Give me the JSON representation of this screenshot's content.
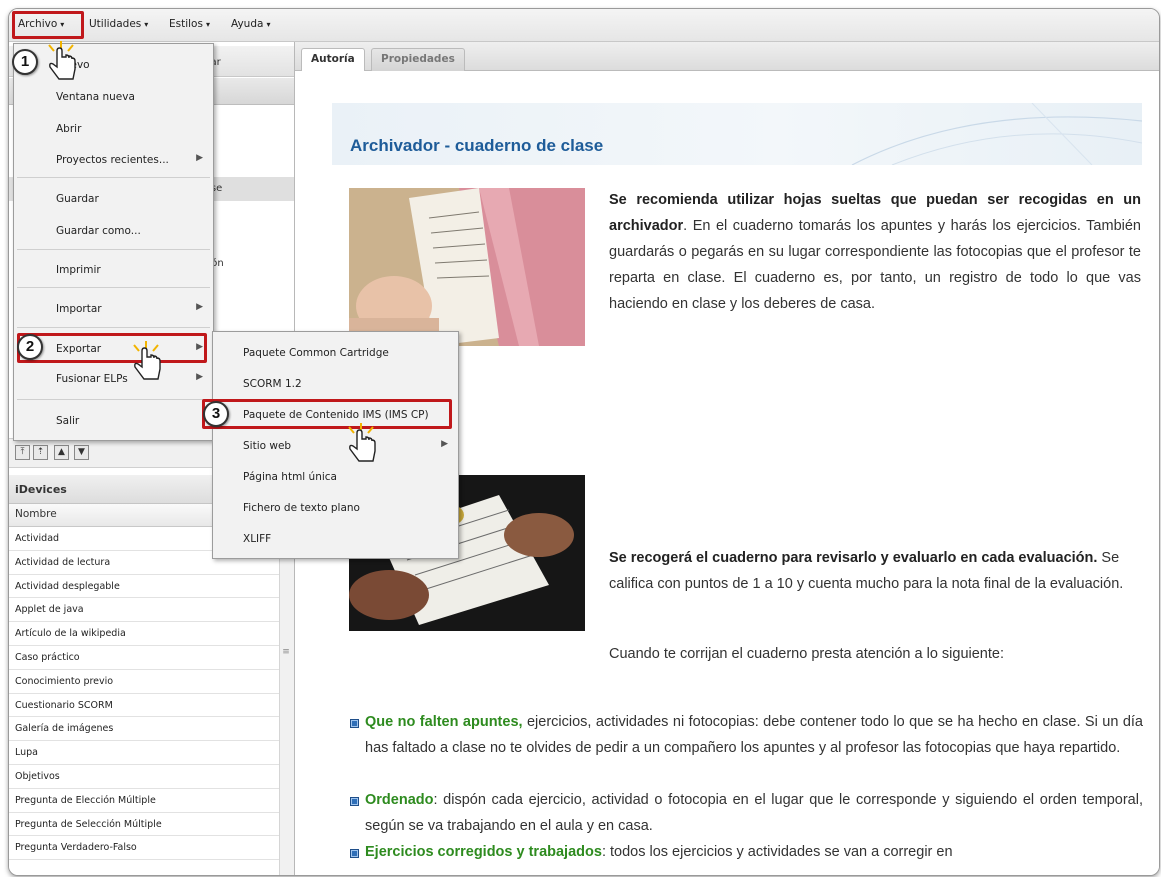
{
  "menubar": {
    "items": [
      {
        "label": "Archivo"
      },
      {
        "label": "Utilidades"
      },
      {
        "label": "Estilos"
      },
      {
        "label": "Ayuda"
      }
    ]
  },
  "outline": {
    "peek_texts": [
      "brar",
      "lase",
      "ción"
    ],
    "arrow_buttons": [
      "top-arrow",
      "up-arrow",
      "down-arrow",
      "bottom-arrow"
    ]
  },
  "idevices": {
    "title": "iDevices",
    "column": "Nombre",
    "items": [
      "Actividad",
      "Actividad de lectura",
      "Actividad desplegable",
      "Applet de java",
      "Artículo de la wikipedia",
      "Caso práctico",
      "Conocimiento previo",
      "Cuestionario SCORM",
      "Galería de imágenes",
      "Lupa",
      "Objetivos",
      "Pregunta de Elección Múltiple",
      "Pregunta de Selección Múltiple",
      "Pregunta Verdadero-Falso"
    ]
  },
  "file_menu": {
    "items": [
      {
        "label": "Nuevo"
      },
      {
        "label": "Ventana nueva"
      },
      {
        "label": "Abrir"
      },
      {
        "label": "Proyectos recientes..."
      },
      {
        "label": "Guardar"
      },
      {
        "label": "Guardar como..."
      },
      {
        "label": "Imprimir"
      },
      {
        "label": "Importar"
      },
      {
        "label": "Exportar"
      },
      {
        "label": "Fusionar ELPs"
      },
      {
        "label": "Salir"
      }
    ]
  },
  "export_menu": {
    "items": [
      {
        "label": "Paquete Common Cartridge"
      },
      {
        "label": "SCORM 1.2"
      },
      {
        "label": "Paquete de Contenido IMS (IMS CP)"
      },
      {
        "label": "Sitio web"
      },
      {
        "label": "Página html única"
      },
      {
        "label": "Fichero de texto plano"
      },
      {
        "label": "XLIFF"
      }
    ]
  },
  "steps": [
    "1",
    "2",
    "3"
  ],
  "tabs": [
    {
      "label": "Autoría",
      "active": true
    },
    {
      "label": "Propiedades",
      "active": false
    }
  ],
  "content": {
    "title": "Archivador - cuaderno de clase",
    "p1_bold": "Se recomienda utilizar hojas sueltas que puedan ser recogidas en un archivador",
    "p1_rest": ". En el cuaderno tomarás los apuntes y harás los ejercicios. También guardarás o pegarás en su lugar correspondiente las fotocopias que el profesor te reparta en clase. El cuaderno es, por tanto, un registro de todo lo que vas haciendo en clase y los deberes de casa.",
    "p2_bold": "Se recogerá el cuaderno para revisarlo y evaluarlo en cada evaluación.",
    "p2_rest": " Se califica con puntos de 1 a 10 y cuenta mucho para la nota final de la evaluación.",
    "p3": "Cuando te corrijan el cuaderno presta atención a lo siguiente:",
    "bullets": [
      {
        "lead": "Que no falten apuntes,",
        "text": " ejercicios, actividades ni fotocopias: debe contener todo lo que se ha hecho en clase. Si un día has faltado a clase no te olvides de pedir a un compañero los apuntes y al profesor las fotocopias que haya repartido."
      },
      {
        "lead": "Ordenado",
        "text": ": dispón cada ejercicio, actividad o fotocopia en el lugar que le corresponde y siguiendo el orden temporal, según se va trabajando en el aula y en casa."
      },
      {
        "lead": "Ejercicios corregidos y trabajados",
        "text": ": todos los ejercicios y actividades se van a corregir en"
      }
    ]
  },
  "colors": {
    "accent_red": "#c0181b",
    "title_blue": "#1e5c99",
    "lead_green": "#2e8b1f"
  }
}
